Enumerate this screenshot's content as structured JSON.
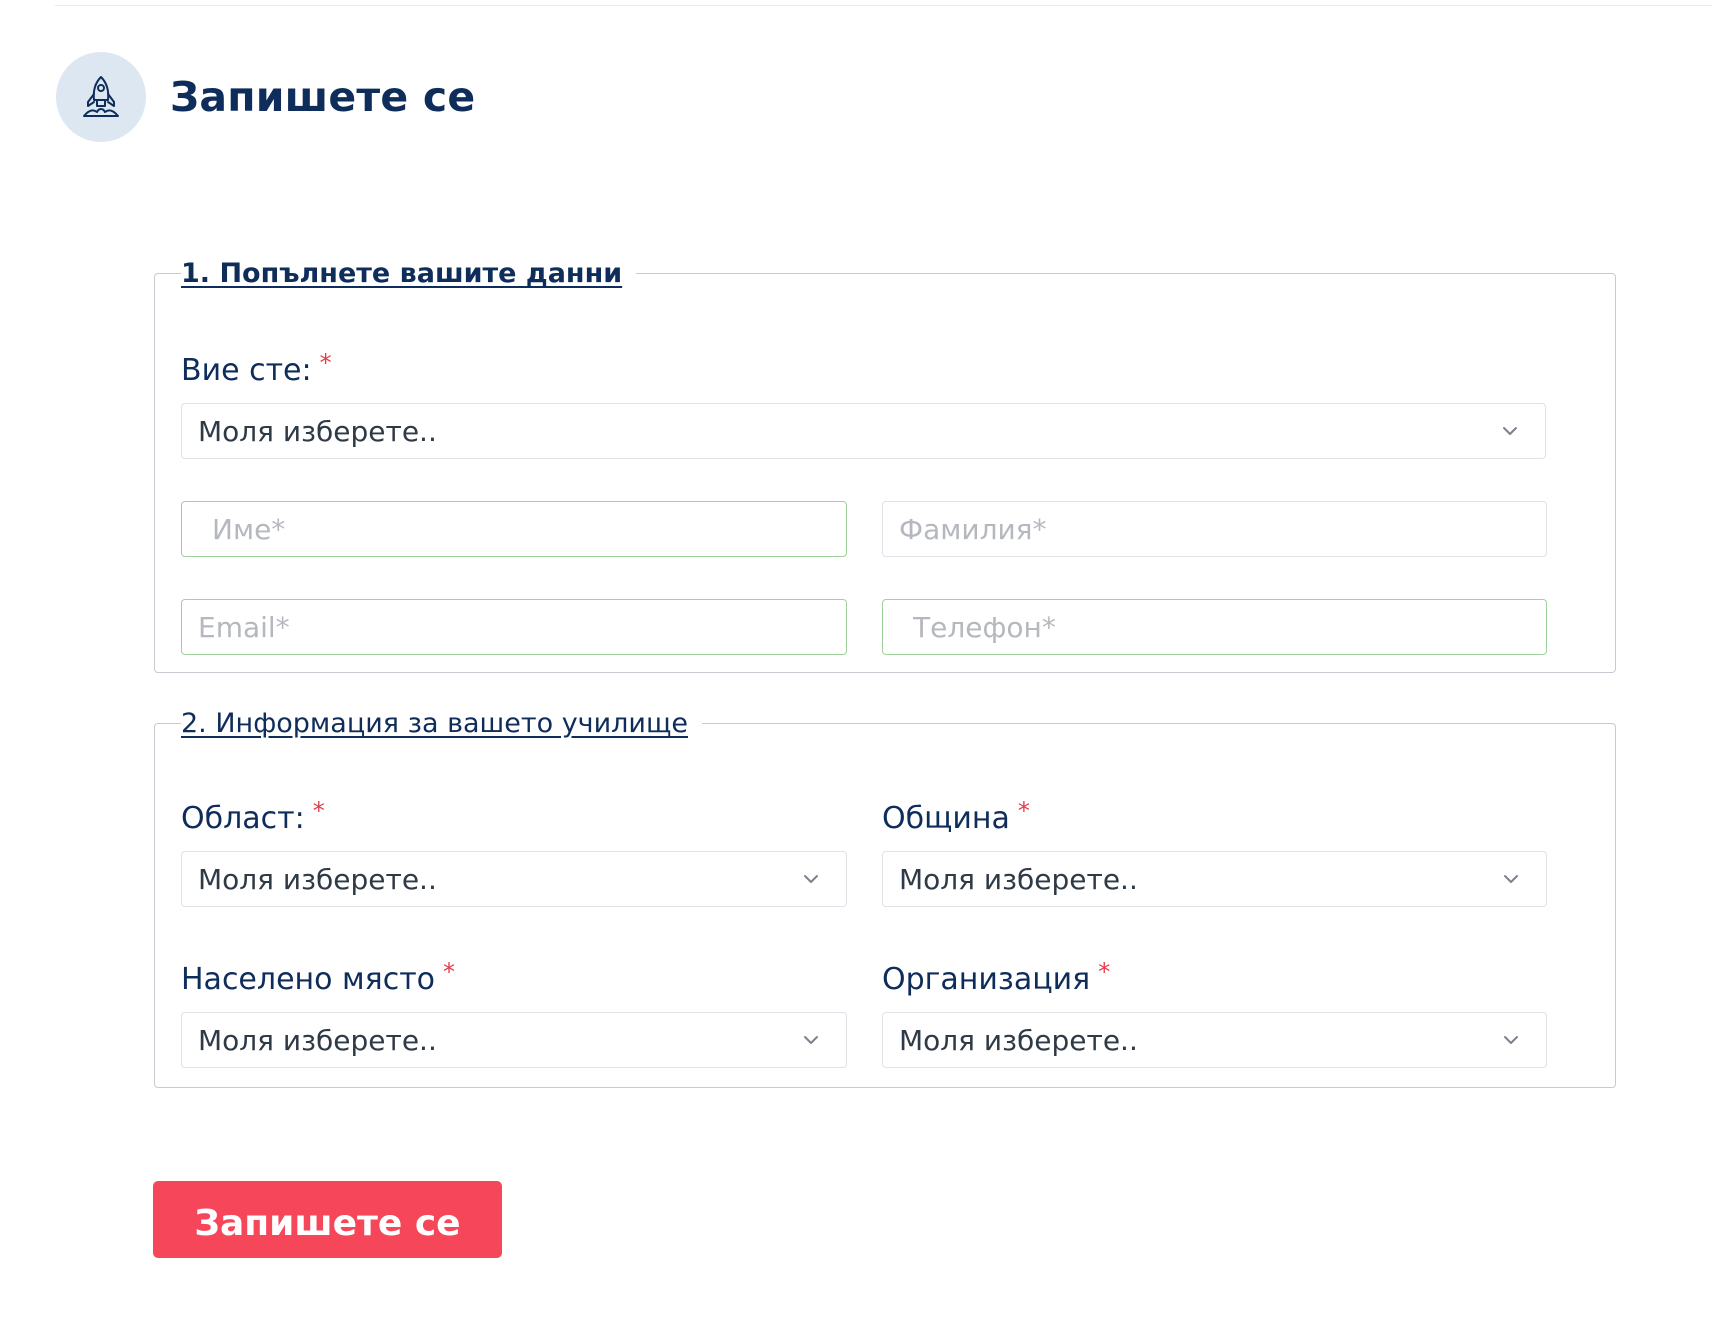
{
  "header": {
    "title": "Запишете се",
    "icon": "rocket-icon"
  },
  "section_1": {
    "legend": "1. Попълнете вашите данни",
    "role": {
      "label": "Вие сте:",
      "required_mark": "*",
      "value": "Моля изберете.."
    },
    "first_name": {
      "placeholder": "Име*"
    },
    "last_name": {
      "placeholder": "Фамилия*"
    },
    "email": {
      "placeholder": "Email*"
    },
    "phone": {
      "placeholder": "Телефон*"
    }
  },
  "section_2": {
    "legend": "2. Информация за вашето училище",
    "region": {
      "label": "Област:",
      "required_mark": "*",
      "value": "Моля изберете.."
    },
    "municipality": {
      "label": "Община",
      "required_mark": "*",
      "value": "Моля изберете.."
    },
    "settlement": {
      "label": "Населено място",
      "required_mark": "*",
      "value": "Моля изберете.."
    },
    "organization": {
      "label": "Организация",
      "required_mark": "*",
      "value": "Моля изберете.."
    }
  },
  "submit": {
    "label": "Запишете се"
  },
  "colors": {
    "primary_text": "#0f2d5a",
    "required_star": "#e03e4b",
    "submit_bg": "#f6475a",
    "icon_circle_bg": "#dde7f1",
    "valid_border": "#9fd29a"
  }
}
